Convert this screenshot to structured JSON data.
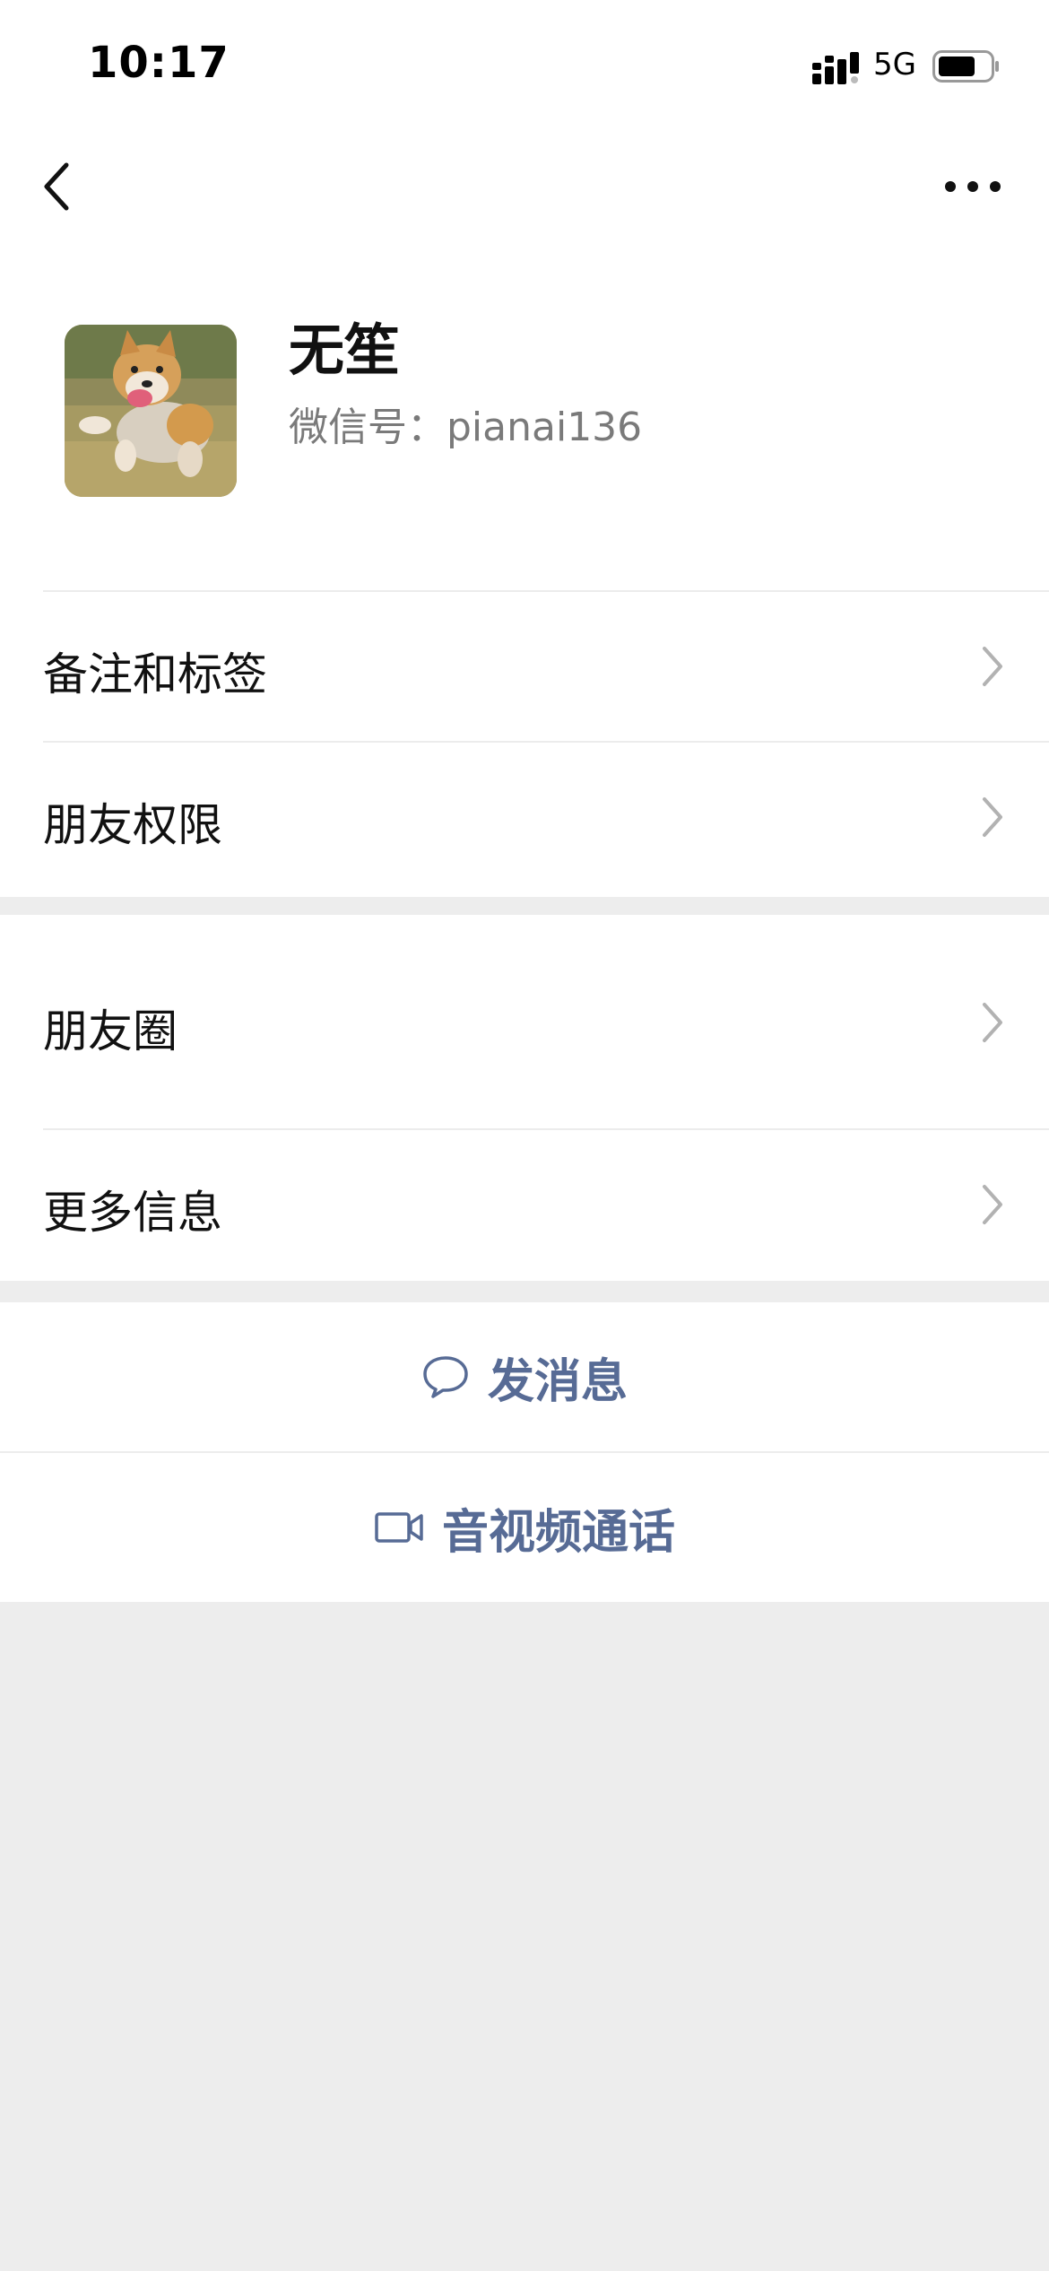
{
  "status_bar": {
    "time": "10:17",
    "network": "5G",
    "signal_icon": "signal-bars-icon",
    "battery_icon": "battery-icon"
  },
  "nav": {
    "back_icon": "back-chevron-icon",
    "more_icon": "more-dots-icon"
  },
  "profile": {
    "name": "无笙",
    "wechat_id": "微信号：pianai136",
    "avatar_icon": "corgi-avatar"
  },
  "section1": {
    "items": [
      {
        "label": "备注和标签"
      },
      {
        "label": "朋友权限"
      }
    ]
  },
  "section2": {
    "items": [
      {
        "label": "朋友圈"
      },
      {
        "label": "更多信息"
      }
    ]
  },
  "actions": {
    "send_message": "发消息",
    "video_call": "音视频通话"
  },
  "colors": {
    "link": "#576b95",
    "background": "#ededed",
    "surface": "#ffffff",
    "chevron": "#b2b2b2"
  }
}
